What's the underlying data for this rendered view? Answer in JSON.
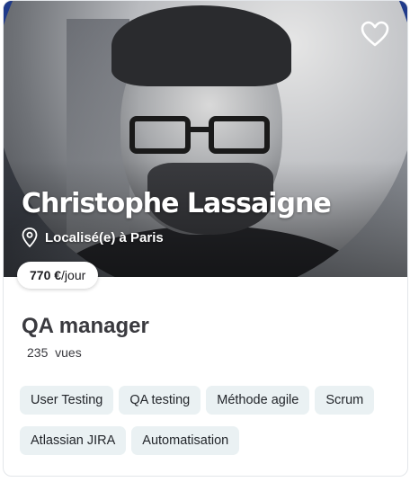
{
  "profile": {
    "name": "Christophe Lassaigne",
    "location": "Localisé(e) à Paris",
    "rate_value": "770 €",
    "rate_unit": "/jour",
    "title": "QA manager",
    "views_count": "235",
    "views_label": "vues"
  },
  "tags": [
    "User Testing",
    "QA testing",
    "Méthode agile",
    "Scrum",
    "Atlassian JIRA",
    "Automatisation"
  ],
  "icons": {
    "favorite": "heart-icon",
    "location": "location-pin-icon"
  },
  "colors": {
    "accent_blue": "#1f3a8a",
    "tag_bg": "#eaf1f3",
    "text": "#3a3a3f"
  }
}
